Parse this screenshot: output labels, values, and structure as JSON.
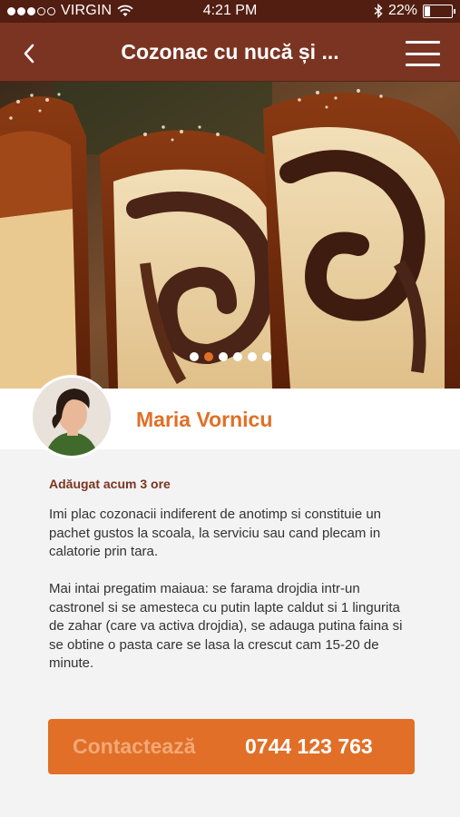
{
  "status_bar": {
    "carrier": "VIRGIN",
    "time": "4:21 PM",
    "battery": "22%",
    "battery_level": 0.22,
    "signal_bars_filled": 3,
    "signal_bars_total": 5
  },
  "nav": {
    "title": "Cozonac cu nucă și ...",
    "back_icon": "chevron-left-icon",
    "menu_icon": "hamburger-menu-icon"
  },
  "gallery": {
    "image_count": 6,
    "active_index": 1
  },
  "author": {
    "name": "Maria Vornicu"
  },
  "post": {
    "added": "Adăugat acum 3 ore",
    "paragraph1": "Imi plac cozonacii indiferent de anotimp si constituie un pachet gustos la scoala, la serviciu sau cand plecam in calatorie prin tara.",
    "paragraph2": "Mai intai pregatim maiaua: se farama drojdia intr-un castronel si se amesteca cu putin lapte caldut si 1 lingurita de zahar (care va activa drojdia), se adauga putina faina si se obtine o pasta care se lasa la crescut cam 15-20 de minute."
  },
  "contact": {
    "label": "Contactează",
    "phone": "0744 123 763"
  },
  "colors": {
    "status_bar": "#521e12",
    "nav_bar": "#7b3422",
    "accent": "#e16f27",
    "author_name": "#e16f27",
    "added_text": "#7b3422"
  }
}
